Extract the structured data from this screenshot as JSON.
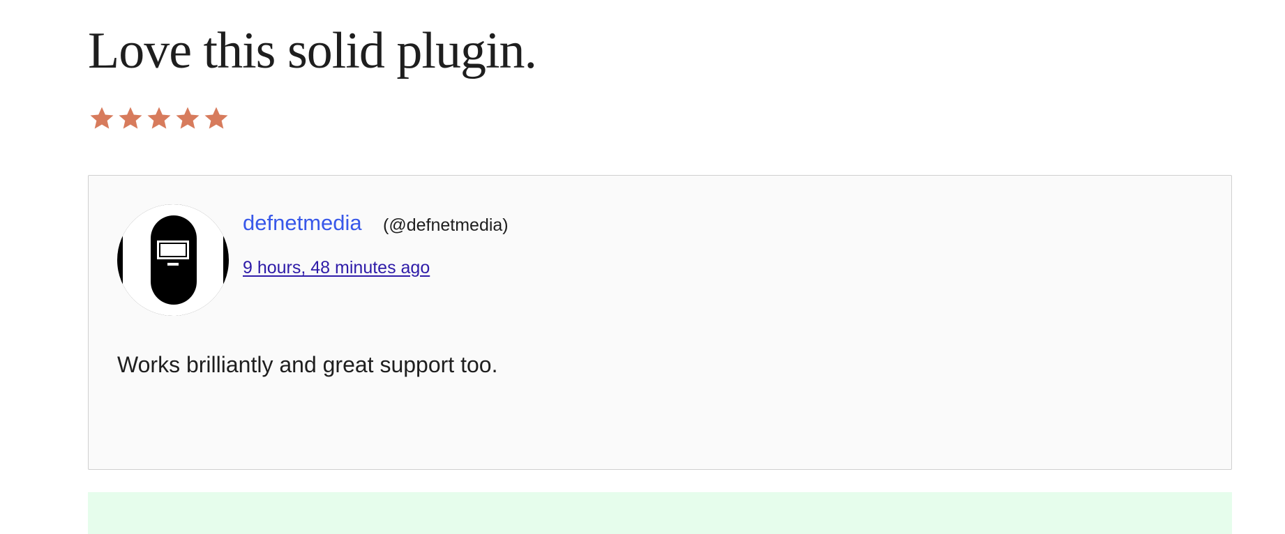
{
  "review": {
    "title": "Love this solid plugin.",
    "rating": 5,
    "rating_max": 5,
    "star_color": "#d77b5c",
    "body": "Works brilliantly and great support too."
  },
  "author": {
    "name": "defnetmedia",
    "handle": "(@defnetmedia)",
    "posted_ago": "9 hours, 48 minutes ago",
    "link_color": "#3858e9"
  },
  "icons": {
    "star": "star-icon",
    "avatar": "user-avatar-image"
  }
}
